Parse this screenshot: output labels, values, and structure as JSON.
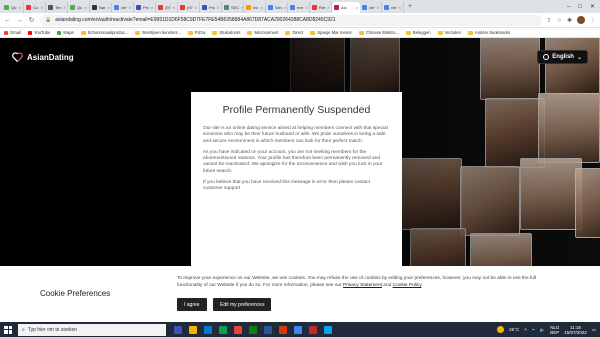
{
  "browser": {
    "tabs": [
      {
        "label": "Qu",
        "color": "#4caf50"
      },
      {
        "label": "Co",
        "color": "#e53935"
      },
      {
        "label": "Ten",
        "color": "#555555"
      },
      {
        "label": "Qu",
        "color": "#4caf50"
      },
      {
        "label": "Nar",
        "color": "#333333"
      },
      {
        "label": "ver",
        "color": "#4285f4"
      },
      {
        "label": "Prc",
        "color": "#3f51b5"
      },
      {
        "label": "(97",
        "color": "#e53935"
      },
      {
        "label": "(97",
        "color": "#e53935"
      },
      {
        "label": "Prc",
        "color": "#3f51b5"
      },
      {
        "label": "SEC",
        "color": "#607d8b"
      },
      {
        "label": "Inc",
        "color": "#ff9800"
      },
      {
        "label": "Gev",
        "color": "#4285f4"
      },
      {
        "label": "eve",
        "color": "#4285f4"
      },
      {
        "label": "Ret",
        "color": "#e53935"
      },
      {
        "label": "Asi",
        "color": "#c2185b",
        "active": true
      },
      {
        "label": "ver",
        "color": "#4285f4"
      },
      {
        "label": "ver",
        "color": "#4285f4"
      }
    ],
    "url": "asiandating.com/en/auth/reactivate?email=E9951D1D6F58C9D7FE7FE54B6358984A867D87ACA290264388CA8D8245C921",
    "bookmarks": [
      {
        "label": "Gmail",
        "type": "fav",
        "color": "#ea4335"
      },
      {
        "label": "YouTube",
        "type": "fav",
        "color": "#ff0000"
      },
      {
        "label": "Maps",
        "type": "fav",
        "color": "#34a853"
      },
      {
        "label": "Schoonmaakproduc...",
        "type": "folder"
      },
      {
        "label": "Bestrijven kunstvrs...",
        "type": "folder"
      },
      {
        "label": "Pizza",
        "type": "folder"
      },
      {
        "label": "Stukadoors",
        "type": "folder"
      },
      {
        "label": "Microcement",
        "type": "folder"
      },
      {
        "label": "Direct",
        "type": "folder"
      },
      {
        "label": "Spanje Mar menor",
        "type": "folder"
      },
      {
        "label": "Chinese Elektro...",
        "type": "folder"
      },
      {
        "label": "Beleggen",
        "type": "folder"
      },
      {
        "label": "Verzalen",
        "type": "folder"
      },
      {
        "label": "Andere bookmarks",
        "type": "folder"
      }
    ]
  },
  "site": {
    "logo": "AsianDating",
    "language": "English"
  },
  "modal": {
    "title": "Profile Permanently Suspended",
    "p1": "Our site is an online dating service aimed at helping members connect with that special someone who may be their future husband or wife. We pride ourselves in being a safe and secure environment in which members can look for their perfect match.",
    "p2": "As you have indicated on your account, you are not seeking members for the aforementioned reasons. Your profile has therefore been permanently removed and cannot be reactivated. We apologize for the inconvenience and wish you luck in your future search.",
    "p3": "If you believe that you have received this message in error then please contact customer support"
  },
  "cookie": {
    "title": "Cookie Preferences",
    "text_before": "To improve your experience on our Website, we use cookies. You may refuse the use of cookies by editing your preferences, however, you may not be able to use the full functionality of our Website if you do so. For more information, please see our ",
    "privacy_link": "Privacy Statement",
    "text_and": " and ",
    "cookie_link": "Cookie Policy",
    "text_end": ".",
    "agree_label": "I agree",
    "edit_label": "Edit my preferences"
  },
  "taskbar": {
    "search_placeholder": "Typ hier om te zoeken",
    "weather": "25°C",
    "lang_top": "NLD",
    "lang_bottom": "BEP",
    "time": "11:18",
    "date": "15/07/2022",
    "apps": [
      "#3f51b5",
      "#f5b400",
      "#0078d4",
      "#0f9d58",
      "#ea4335",
      "#107c10",
      "#2b579a",
      "#d83b01",
      "#4285f4",
      "#c62828",
      "#00a4ef"
    ]
  }
}
